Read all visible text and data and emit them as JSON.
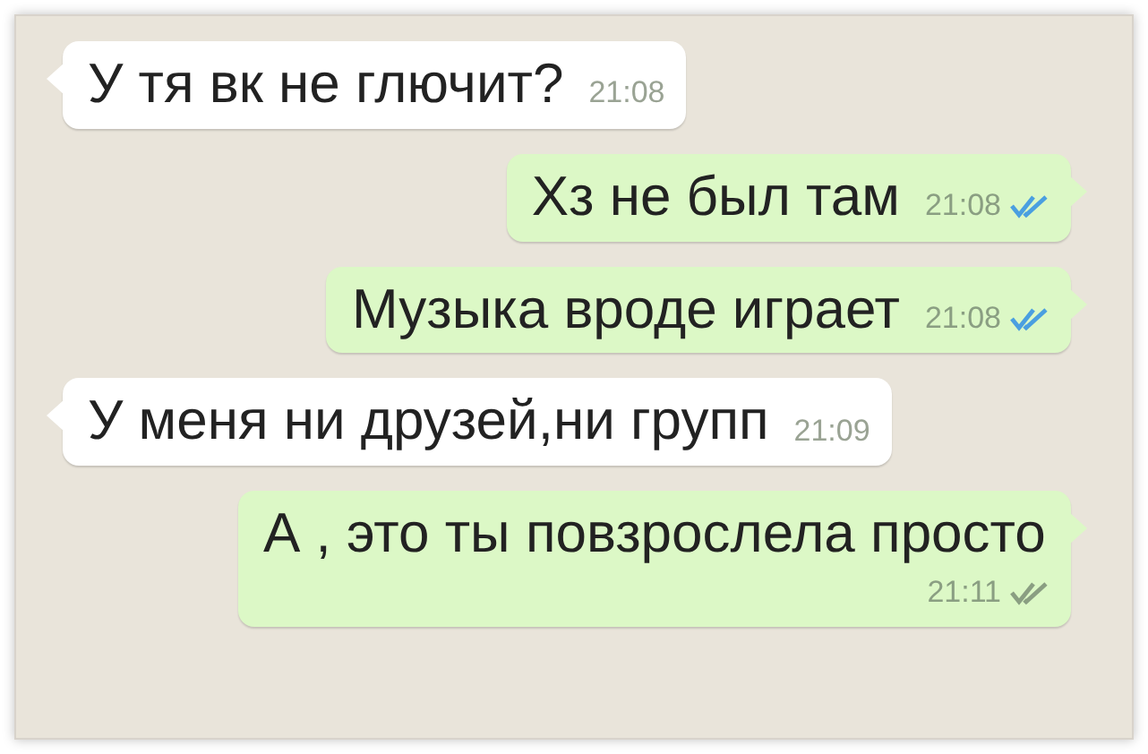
{
  "messages": [
    {
      "outgoing": false,
      "text": "У тя вк не глючит?",
      "time": "21:08"
    },
    {
      "outgoing": true,
      "text": "Хз не был там",
      "time": "21:08",
      "read": true
    },
    {
      "outgoing": true,
      "text": "Музыка вроде играет",
      "time": "21:08",
      "read": true
    },
    {
      "outgoing": false,
      "text": "У меня ни друзей,ни групп",
      "time": "21:09"
    },
    {
      "outgoing": true,
      "text": "А , это ты повзрослела просто",
      "time": "21:11",
      "read": false
    }
  ]
}
